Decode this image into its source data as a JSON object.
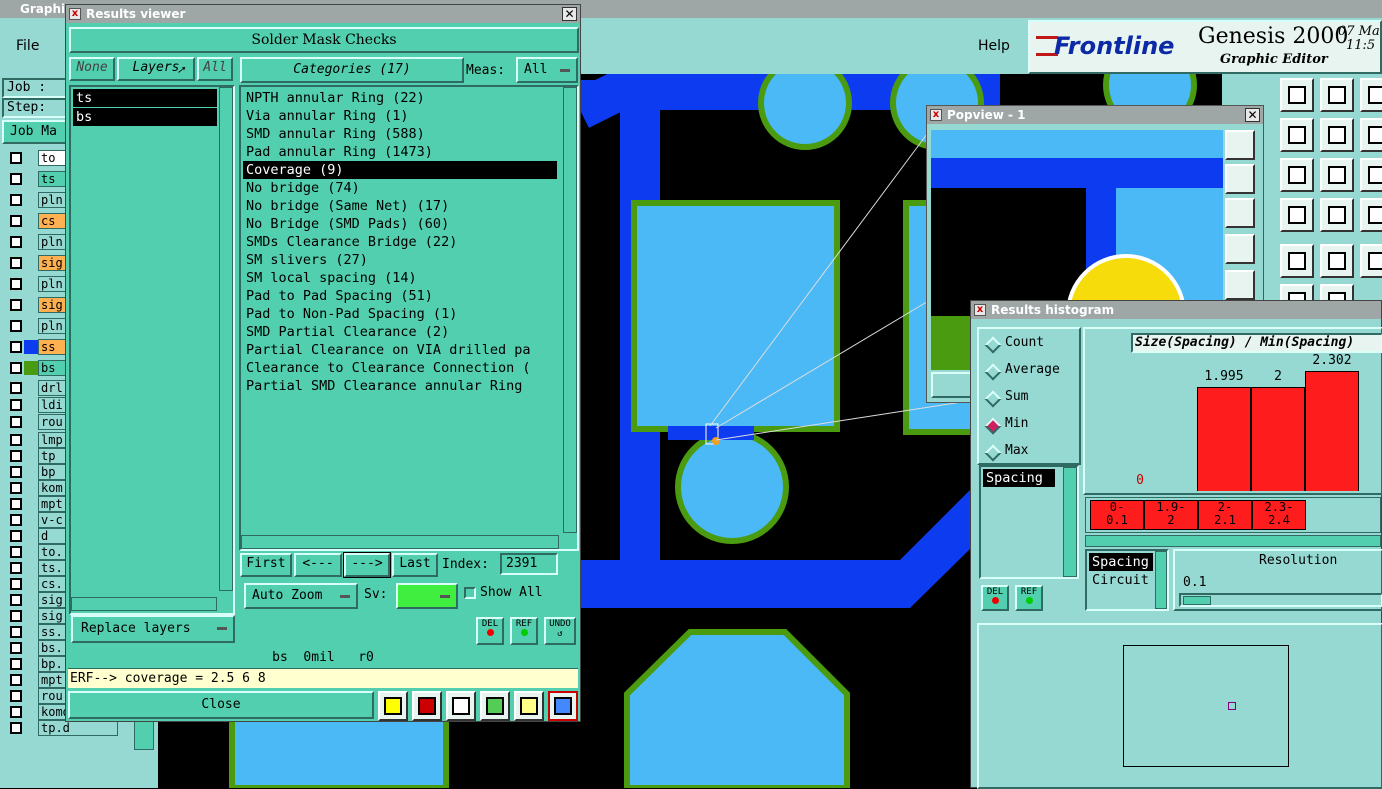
{
  "main": {
    "title": "Graphic",
    "menu": {
      "file": "File",
      "help": "Help"
    },
    "brand": "Frontline",
    "product": "Genesis 2000",
    "subtitle": "Graphic Editor",
    "date_partial": "07 Ma",
    "time_partial": "11:5",
    "job_label": "Job :",
    "step_label": "Step:",
    "job_btn": "Job Ma",
    "layers": [
      "to",
      "ts",
      "pln",
      "cs",
      "pln",
      "sig",
      "pln",
      "sig",
      "pln",
      "ss",
      "bs",
      "drl",
      "ldi",
      "rou",
      "lmp",
      "tp",
      "bp",
      "kom",
      "mpt",
      "v-c",
      "d",
      "to.",
      "ts.",
      "cs.",
      "sig",
      "sig",
      "ss.",
      "bs.",
      "bp.",
      "mpt",
      "rou",
      "komd",
      "tp.d"
    ],
    "colors": {
      "accent": "#52cfae",
      "board": "#000000",
      "pad": "#4ab9f5",
      "trace": "#0d3cf0",
      "mask": "#4a9b10"
    }
  },
  "results": {
    "title": "Results viewer",
    "header": "Solder Mask Checks",
    "none_btn": "None",
    "layers_btn": "Layers",
    "all_btn": "All",
    "categories_btn": "Categories (17)",
    "meas_label": "Meas:",
    "meas_value": "All",
    "layer_items": [
      "ts",
      "bs"
    ],
    "categories": [
      "NPTH annular Ring (22)",
      "Via annular Ring (1)",
      "SMD annular Ring (588)",
      "Pad annular Ring (1473)",
      "Coverage (9)",
      "No bridge (74)",
      "No bridge (Same Net) (17)",
      "No Bridge (SMD Pads) (60)",
      "SMDs Clearance Bridge (22)",
      "SM slivers (27)",
      "SM local spacing (14)",
      "Pad to Pad Spacing (51)",
      "Pad to Non-Pad Spacing (1)",
      "SMD Partial Clearance (2)",
      "Partial Clearance on VIA drilled pa",
      "Clearance to Clearance Connection (",
      "Partial SMD Clearance annular Ring"
    ],
    "selected_index": 4,
    "first_btn": "First",
    "prev_btn": "<---",
    "next_btn": "--->",
    "last_btn": "Last",
    "index_label": "Index:",
    "index_value": "2391",
    "auto_zoom": "Auto Zoom",
    "sv_label": "Sv:",
    "show_all": "Show All",
    "replace_layers": "Replace layers",
    "del": "DEL",
    "ref": "REF",
    "undo": "UNDO",
    "status": "bs  0mil   r0",
    "erf": "ERF--> coverage = 2.5 6 8",
    "close": "Close"
  },
  "popview": {
    "title": "Popview - 1"
  },
  "histogram": {
    "title": "Results histogram",
    "options": [
      "Count",
      "Average",
      "Sum",
      "Min",
      "Max"
    ],
    "selected_option": "Min",
    "list_items": [
      "Spacing"
    ],
    "del": "DEL",
    "ref": "REF",
    "mode_items": [
      "Spacing",
      "Circuit"
    ],
    "resolution_label": "Resolution",
    "resolution_value": "0.1",
    "chart_data": {
      "type": "bar",
      "title": "Size(Spacing) / Min(Spacing)",
      "categories": [
        "0-\n0.1",
        "1.9-\n2",
        "2-\n2.1",
        "2.3-\n2.4"
      ],
      "values": [
        0,
        1.995,
        2,
        2.302
      ],
      "value_labels": [
        "0",
        "1.995",
        "2",
        "2.302"
      ],
      "ylim": [
        0,
        2.302
      ]
    }
  }
}
